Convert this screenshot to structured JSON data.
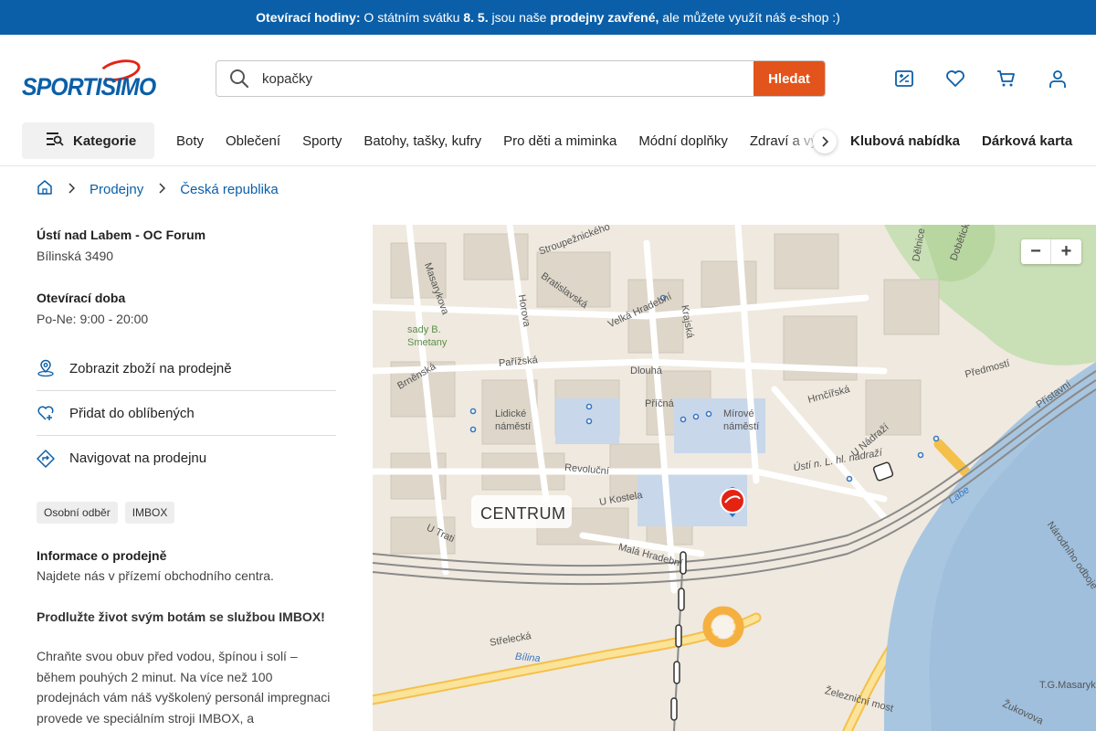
{
  "announcement": {
    "lead": "Otevírací hodiny:",
    "t1": " O státním svátku ",
    "date": "8. 5.",
    "t2": " jsou naše ",
    "closed": "prodejny zavřené,",
    "t3": " ale můžete využít náš e-shop :)"
  },
  "brand": {
    "name": "SPORTISIMO"
  },
  "search": {
    "value": "kopačky",
    "button": "Hledat"
  },
  "header_icons": [
    "compare-icon",
    "heart-icon",
    "cart-icon",
    "user-icon"
  ],
  "nav": {
    "category_button": "Kategorie",
    "items": [
      "Boty",
      "Oblečení",
      "Sporty",
      "Batohy, tašky, kufry",
      "Pro děti a miminka",
      "Módní doplňky",
      "Zdraví a výživa"
    ],
    "highlight": [
      "Klubová nabídka",
      "Dárková karta"
    ]
  },
  "breadcrumb": [
    "Prodejny",
    "Česká republika"
  ],
  "store": {
    "name": "Ústí nad Labem - OC Forum",
    "address": "Bílinská 3490",
    "hours_label": "Otevírací doba",
    "hours": "Po-Ne: 9:00 - 20:00",
    "actions": [
      {
        "label": "Zobrazit zboží na prodejně",
        "icon": "map-pin-icon"
      },
      {
        "label": "Přidat do oblíbených",
        "icon": "heart-plus-icon"
      },
      {
        "label": "Navigovat na prodejnu",
        "icon": "navigate-icon"
      }
    ],
    "tags": [
      "Osobní odběr",
      "IMBOX"
    ],
    "about_label": "Informace o prodejně",
    "about_text": "Najdete nás v přízemí obchodního centra.",
    "promo_title": "Prodlužte život svým botám se službou IMBOX!",
    "promo_text": "Chraňte svou obuv před vodou, špínou i solí – během pouhých 2 minut. Na více než 100 prodejnách vám náš vyškolený personál impregnaci provede ve speciálním stroji IMBOX, a"
  },
  "map": {
    "zoom_out": "−",
    "zoom_in": "+",
    "district": "CENTRUM",
    "labels": [
      "Stroupežnického",
      "Bratislavská",
      "Velká Hradební",
      "Masarykova",
      "Horova",
      "Krajská",
      "Pařížská",
      "Dlouhá",
      "Brněnská",
      "Lidické náměstí",
      "Příčná",
      "Mírové náměstí",
      "Hrnčířská",
      "Předmostí",
      "Přístavní",
      "Revoluční",
      "U Kostela",
      "Malá Hradební",
      "U Trati",
      "Střelecká",
      "Bílina",
      "Železniční most",
      "Labe",
      "Národního odboje",
      "Žukovova",
      "T.G.Masaryk",
      "Ústí n. L. hl. nádraží",
      "U Nádraží",
      "sady B. Smetany",
      "Dělnice",
      "Dobětická"
    ]
  }
}
